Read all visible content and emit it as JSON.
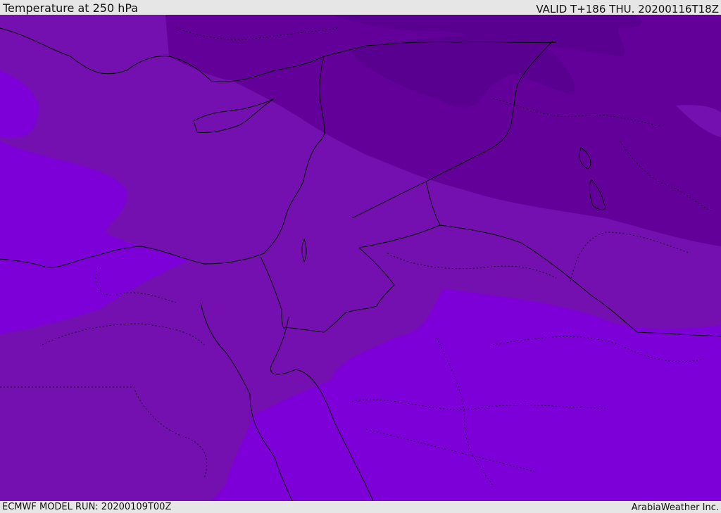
{
  "header": {
    "title": "Temperature at 250 hPa",
    "valid": "VALID T+186 THU. 20200116T18Z"
  },
  "footer": {
    "model_run": "ECMWF MODEL RUN: 20200109T00Z",
    "credit": "ArabiaWeather Inc."
  },
  "map": {
    "colors": {
      "coldest": "#5a0090",
      "cold": "#63009a",
      "medium": "#7410b0",
      "warm": "#7e00d8",
      "coastline": "#000000"
    }
  }
}
